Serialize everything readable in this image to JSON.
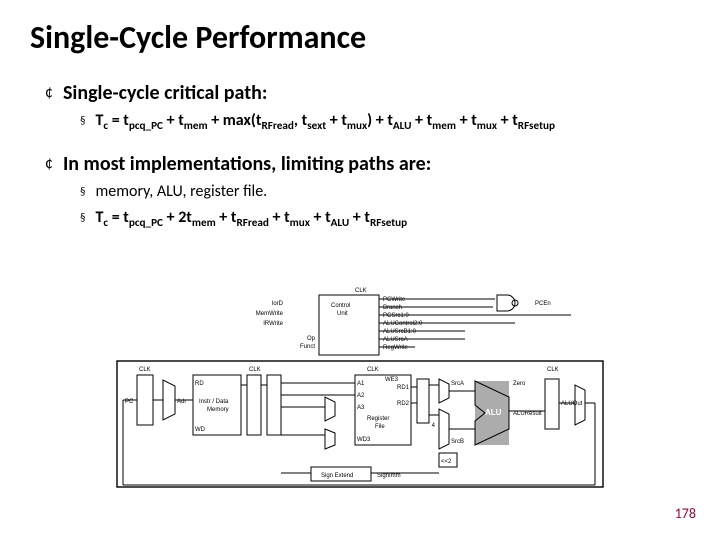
{
  "title": "Single-Cycle Performance",
  "bullets": [
    {
      "text": "Single-cycle critical path:",
      "subs": [
        {
          "type": "formula1"
        }
      ]
    },
    {
      "text": "In most implementations, limiting paths are:",
      "subs": [
        {
          "text": "memory, ALU, register file."
        },
        {
          "type": "formula2"
        }
      ]
    }
  ],
  "formula1_parts": {
    "lhs": "T",
    "lhs_sub": "c",
    "eq": " = t",
    "s1": "pcq_PC",
    "p2": " + t",
    "s2": "mem",
    "p3": " + max(t",
    "s3": "RFread",
    "p4": ", t",
    "s4": "sext",
    "p5": " + t",
    "s5": "mux",
    "p6": ") + t",
    "s6": "ALU",
    "p7": " + t",
    "s7": "mem",
    "p8": " + t",
    "s8": "mux",
    "p9": " + t",
    "s9": "RFsetup"
  },
  "formula2_parts": {
    "lhs": "T",
    "lhs_sub": "c",
    "eq": " = t",
    "s1": "pcq_PC",
    "p2": " + 2t",
    "s2": "mem",
    "p3": " + t",
    "s3": "RFread",
    "p4": " + t",
    "s4": "mux",
    "p5": " + t",
    "s5": "ALU",
    "p6": " + t",
    "s6": "RFsetup"
  },
  "diagram_labels": {
    "clk": "CLK",
    "control": "Control",
    "unit": "Unit",
    "instr_data_mem": "Instr / Data",
    "memory": "Memory",
    "regfile": "Register",
    "file": "File",
    "signext": "Sign Extend",
    "pc": "PC",
    "pcen": "PCEn",
    "pcwrite": "PCWrite",
    "branch": "Branch",
    "pcsrc": "PCSrc1:0",
    "alucontrol": "ALUControl2:0",
    "alusrcb": "ALUSrcB1:0",
    "alusrca": "ALUSrcA",
    "regwrite": "RegWrite",
    "iord": "IorD",
    "memwrite": "MemWrite",
    "irwrite": "IRWrite",
    "op": "Op",
    "funct": "Funct",
    "rd": "RD",
    "wd": "WD",
    "adr": "Adr",
    "a1": "A1",
    "a2": "A2",
    "a3": "A3",
    "wd3": "WD3",
    "we3": "WE3",
    "rd1": "RD1",
    "rd2": "RD2",
    "alu": "ALU",
    "srca": "SrcA",
    "srcb": "SrcB",
    "zero": "Zero",
    "aluout": "ALUOut",
    "aluresult": "ALUResult",
    "signimm": "SignImm",
    "shift": "<<2",
    "four": "4"
  },
  "page_number": "178"
}
